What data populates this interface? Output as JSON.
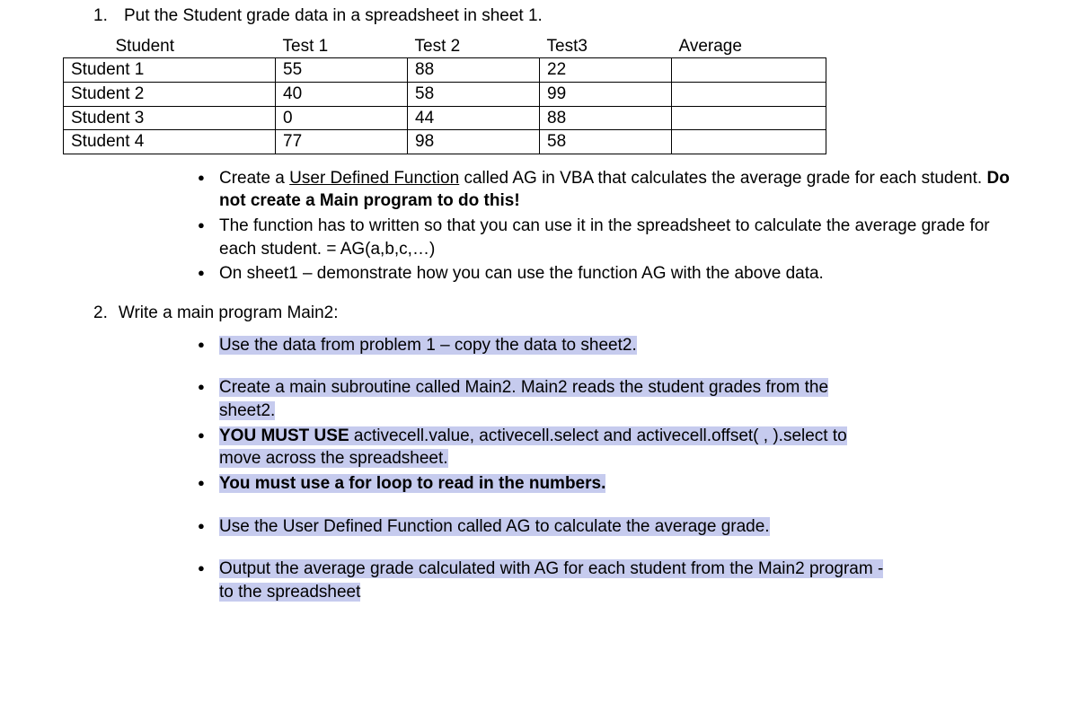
{
  "q1": {
    "number": "1.",
    "prompt": "Put the Student grade data in a spreadsheet in sheet 1."
  },
  "table": {
    "headers": [
      "Student",
      "Test 1",
      "Test 2",
      "Test3",
      "Average"
    ],
    "rows": [
      [
        "Student 1",
        "55",
        "88",
        "22",
        ""
      ],
      [
        "Student 2",
        "40",
        "58",
        "99",
        ""
      ],
      [
        "Student 3",
        "0",
        "44",
        "88",
        ""
      ],
      [
        "Student 4",
        "77",
        "98",
        "58",
        ""
      ]
    ]
  },
  "q1_bullets": {
    "b0_a": "Create a ",
    "b0_u": "User Defined Function",
    "b0_b": " called AG in VBA that calculates the average grade for each student. ",
    "b0_bold": "Do not create a Main program to do this!",
    "b1": "The function has to written so that you can use it in the spreadsheet to calculate the average grade for each student.  = AG(a,b,c,…)",
    "b2": "On sheet1 – demonstrate how you can use the function AG with the above data."
  },
  "q2": {
    "number": "2.",
    "prompt": "Write a main program Main2:"
  },
  "q2_bullets": {
    "g1_b0": "Use the data from problem 1 – copy the data to sheet2.",
    "g2_b0_a": " Create a main subroutine called Main2. Main2 reads the student grades from the",
    "g2_b0_b": "sheet2.",
    "g2_b1_bold": "YOU MUST USE",
    "g2_b1_a": " activecell.value, activecell.select and activecell.offset( , ).select  to",
    "g2_b1_b": "move across the spreadsheet.",
    "g2_b2": "You must use a for loop to read in the numbers.",
    "g3_b0": "Use the User Defined Function called AG to calculate the average grade.",
    "g4_b0_a": "Output the average grade calculated with AG for each student from the Main2 program -",
    "g4_b0_b": "to the spreadsheet"
  }
}
